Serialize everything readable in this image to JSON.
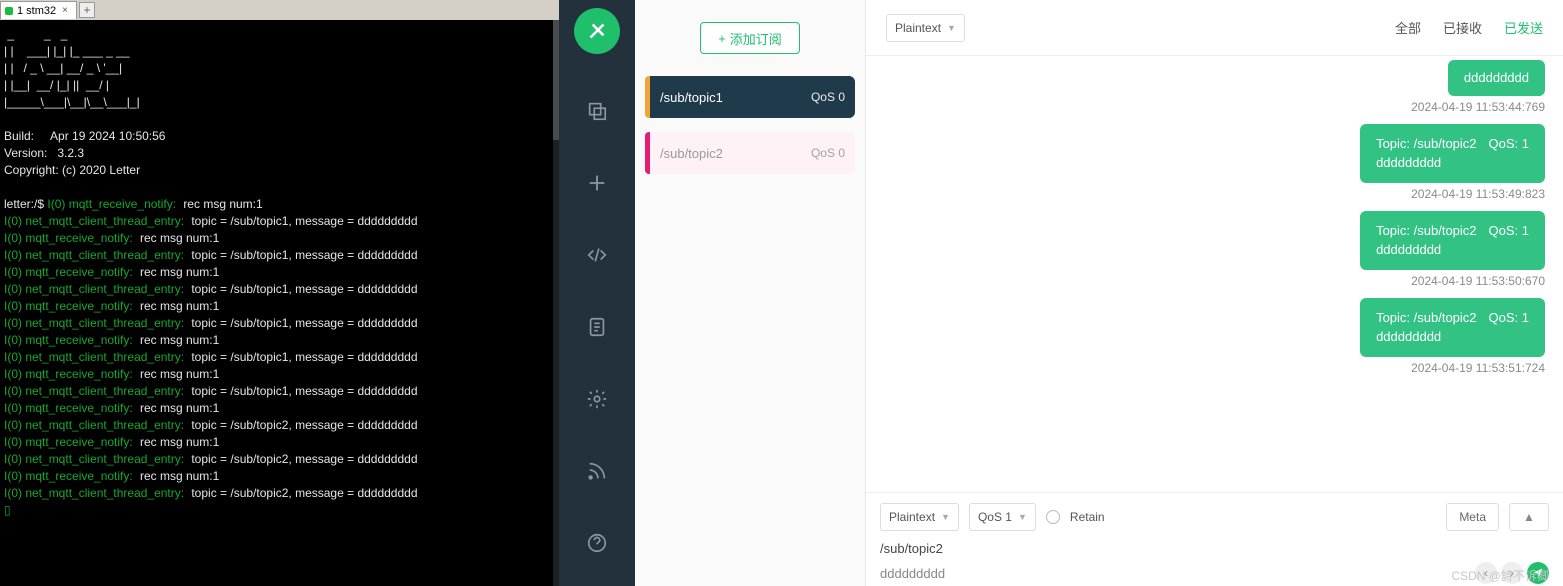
{
  "tab": {
    "title": "1 stm32"
  },
  "terminal": {
    "ascii": " _         _   _\n| |    ___| |_| |_ ___ _ __\n| |   / _ \\ __| __/ _ \\ '__|\n| |__|  __/ |_| ||  __/ |\n|_____\\___|\\__|\\__\\___|_|",
    "build_lbl": "Build:",
    "build_val": "Apr 19 2024 10:50:56",
    "ver_lbl": "Version:",
    "ver_val": "3.2.3",
    "copy_lbl": "Copyright:",
    "copy_val": "(c) 2020 Letter",
    "prompt": "letter:/$ ",
    "tag_first": "I(0) mqtt_receive_notify:",
    "rec": "rec msg num:1",
    "tag_rn": "I(0) mqtt_receive_notify:",
    "tag_ce": "I(0) net_mqtt_client_thread_entry:",
    "msg1": "topic = /sub/topic1, message = ddddddddd",
    "msg2": "topic = /sub/topic2, message = ddddddddd"
  },
  "subs": {
    "add_label": "添加订阅",
    "item0": {
      "name": "/sub/topic1",
      "qos": "QoS 0"
    },
    "item1": {
      "name": "/sub/topic2",
      "qos": "QoS 0"
    }
  },
  "header": {
    "format": "Plaintext",
    "tab_all": "全部",
    "tab_recv": "已接收",
    "tab_sent": "已发送"
  },
  "messages": {
    "m0": {
      "body": "ddddddddd",
      "ts": "2024-04-19 11:53:44:769"
    },
    "m1": {
      "topic": "Topic: /sub/topic2",
      "qos": "QoS: 1",
      "body": "ddddddddd",
      "ts": "2024-04-19 11:53:49:823"
    },
    "m2": {
      "topic": "Topic: /sub/topic2",
      "qos": "QoS: 1",
      "body": "ddddddddd",
      "ts": "2024-04-19 11:53:50:670"
    },
    "m3": {
      "topic": "Topic: /sub/topic2",
      "qos": "QoS: 1",
      "body": "ddddddddd",
      "ts": "2024-04-19 11:53:51:724"
    }
  },
  "composer": {
    "format": "Plaintext",
    "qos": "QoS 1",
    "retain": "Retain",
    "meta": "Meta",
    "topic": "/sub/topic2",
    "body": "ddddddddd"
  },
  "watermark": "CSDN @詩不诉卿"
}
